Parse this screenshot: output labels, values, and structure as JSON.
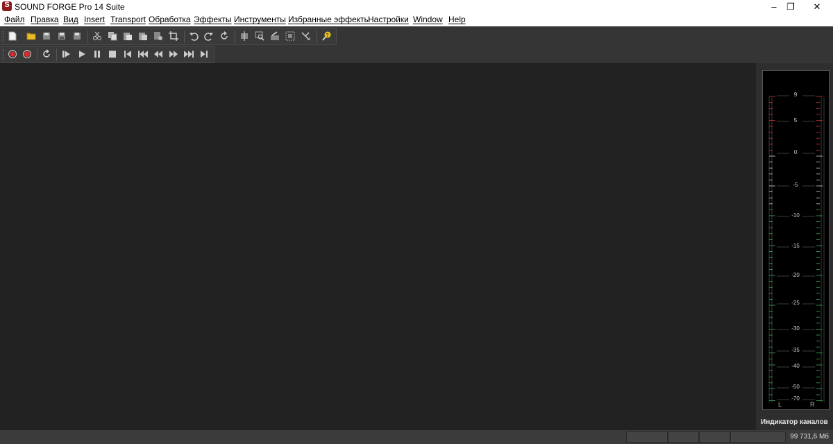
{
  "window": {
    "title": "SOUND FORGE Pro 14 Suite",
    "minimize": "–",
    "maximize": "❐",
    "close": "✕"
  },
  "menu": [
    "Файл",
    "Правка",
    "Вид",
    "Insert",
    "Transport",
    "Обработка",
    "Эффекты",
    "Инструменты",
    "Избранные эффекты",
    "Настройки",
    "Window",
    "Help"
  ],
  "toolbar_main": {
    "icons": [
      "new-file-icon",
      "open-folder-icon",
      "save-icon",
      "save-all-icon",
      "save-as-icon",
      "cut-icon",
      "copy-icon",
      "paste-icon",
      "paste-special-icon",
      "mix-icon",
      "crop-icon",
      "undo-icon",
      "redo-icon",
      "repeat-icon",
      "trim-icon",
      "zoom-selection-icon",
      "region-icon",
      "select-all-icon",
      "snap-icon",
      "help-icon"
    ]
  },
  "toolbar_transport": {
    "icons": [
      "record-settings-icon",
      "record-icon",
      "loop-icon",
      "play-all-icon",
      "play-icon",
      "pause-icon",
      "stop-icon",
      "go-to-start-icon",
      "previous-icon",
      "rewind-icon",
      "fast-forward-icon",
      "next-icon",
      "go-to-end-icon"
    ]
  },
  "meter": {
    "label": "Индикатор каналов",
    "channel_left": "L",
    "channel_right": "R",
    "scale": [
      "9",
      "5",
      "0",
      "-5",
      "-10",
      "-15",
      "-20",
      "-25",
      "-30",
      "-35",
      "-40",
      "-50",
      "-70"
    ],
    "colors": {
      "hot": "#d23a3a",
      "normal": "#d8d8d8",
      "low": "#3cae5a"
    }
  },
  "status": {
    "memory": "99 731,6 Мб"
  }
}
